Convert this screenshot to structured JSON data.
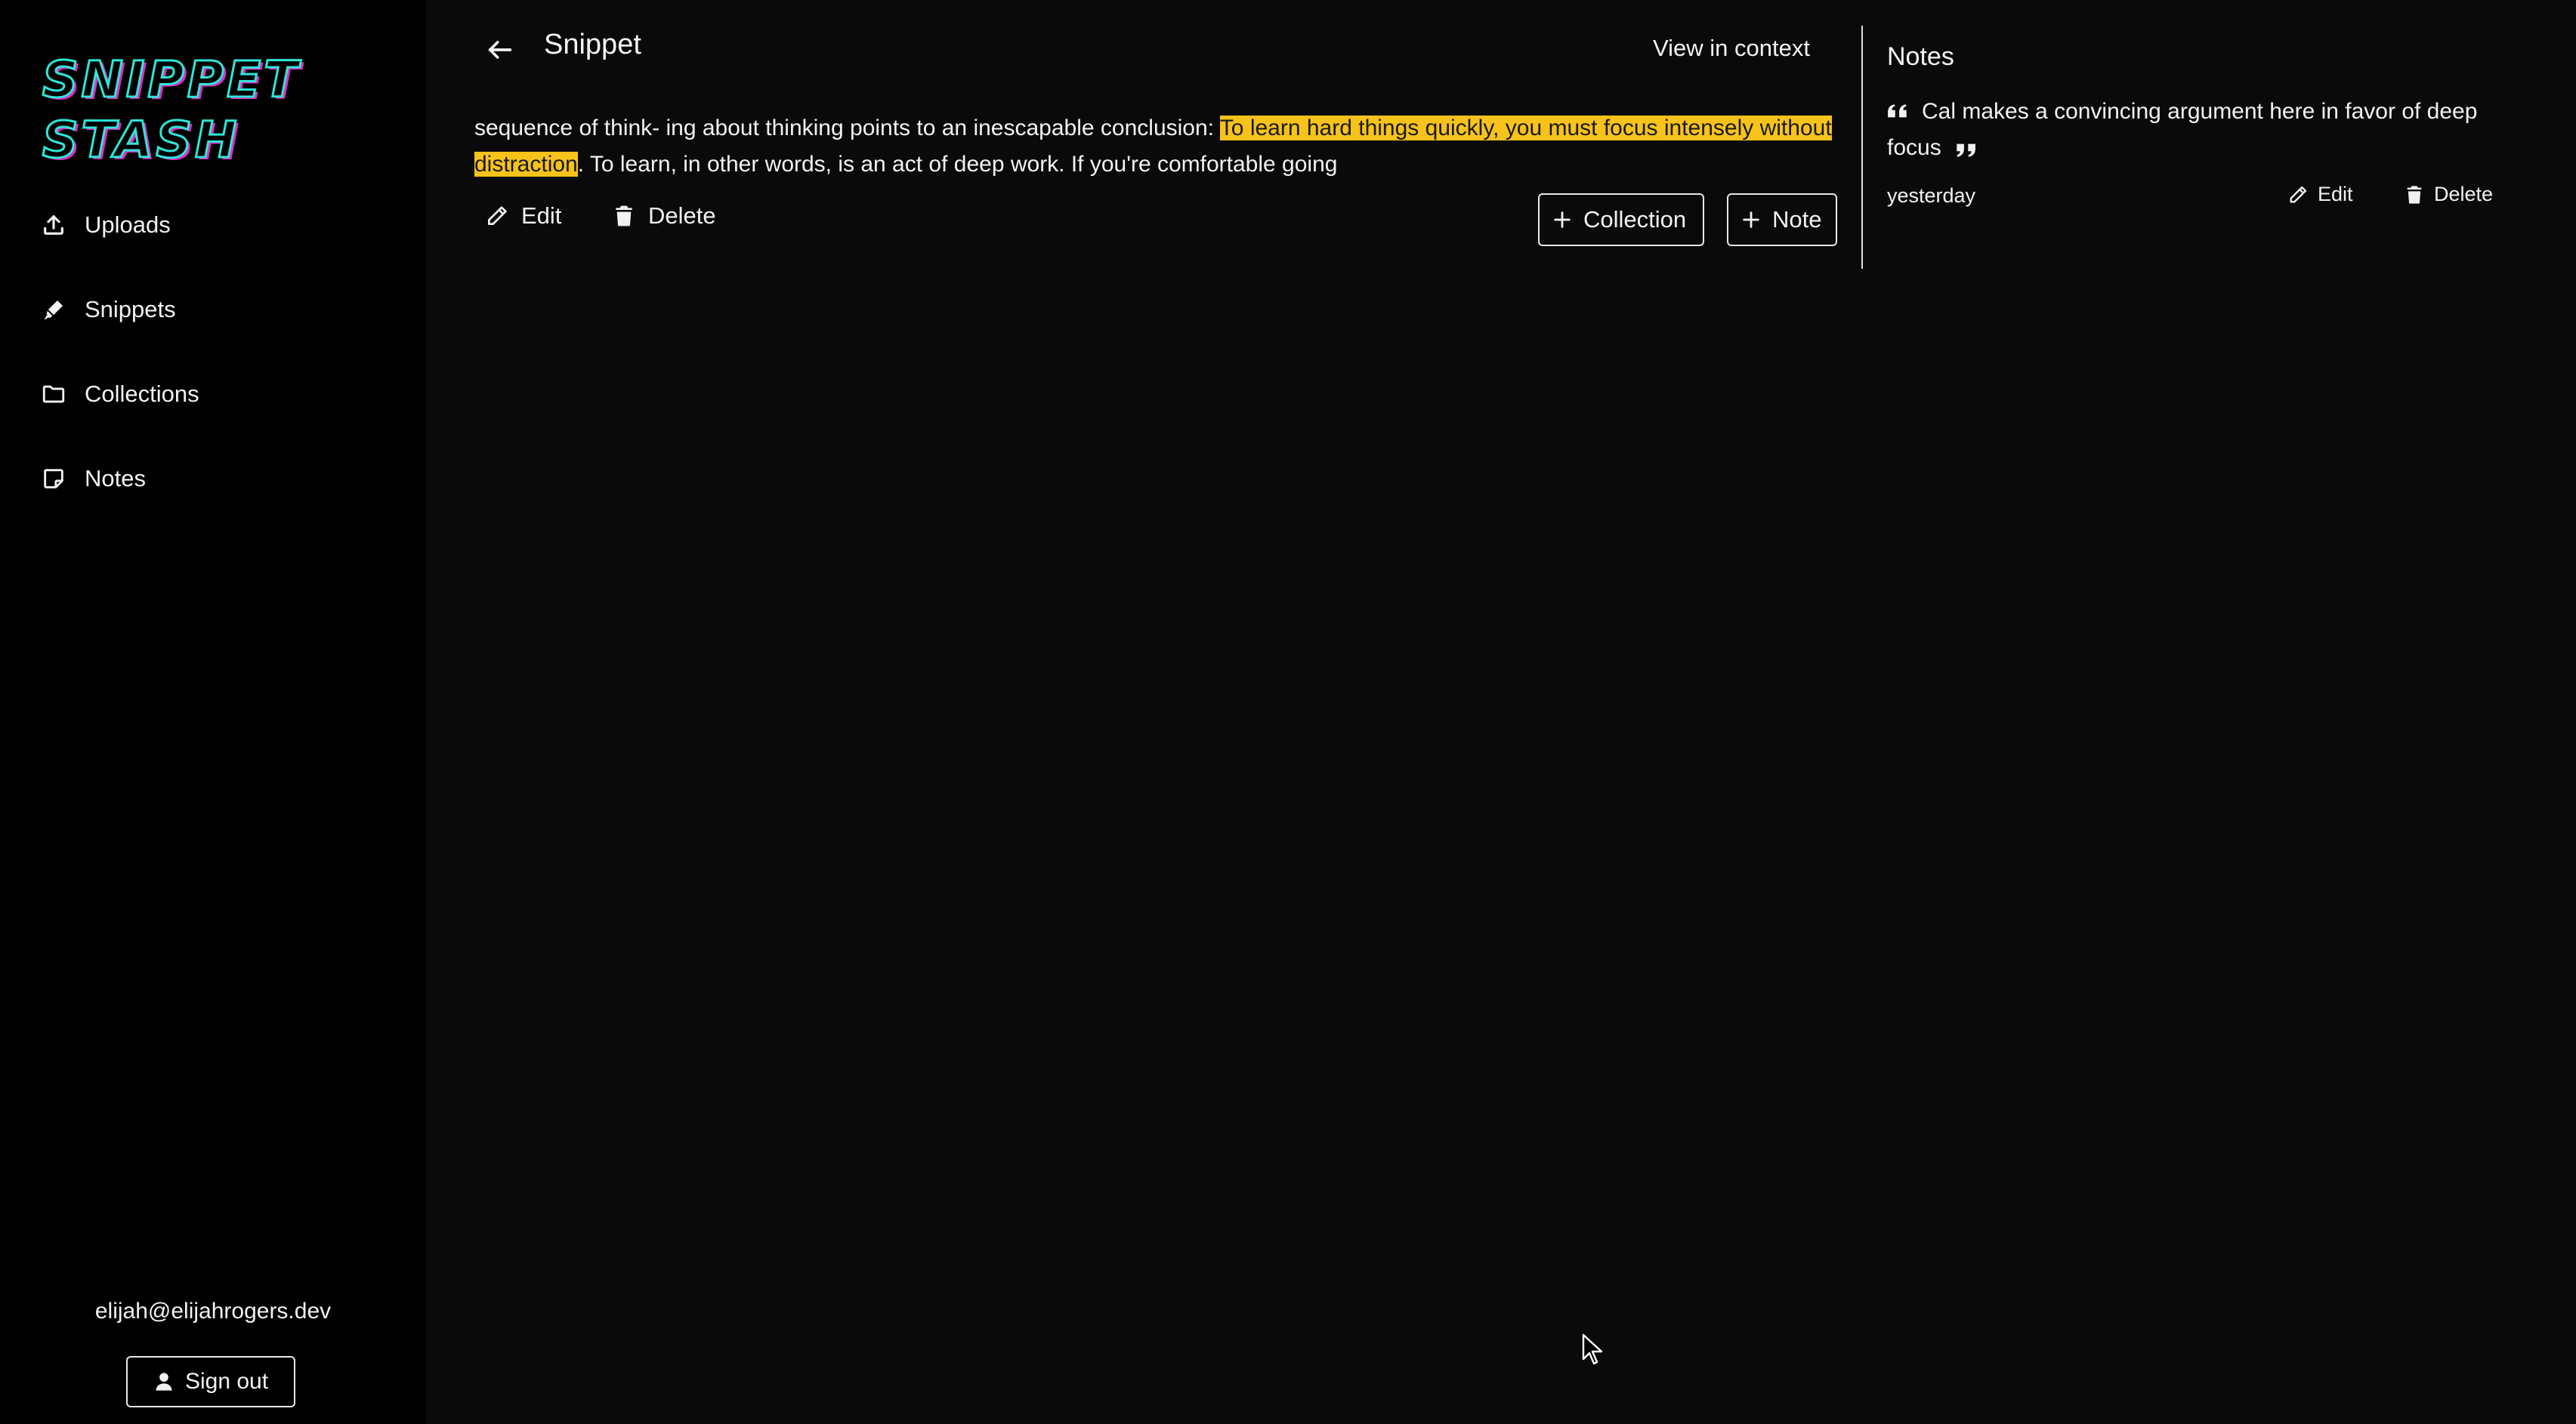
{
  "sidebar": {
    "logo_line1": "SNIPPET",
    "logo_line2": "STASH",
    "items": [
      {
        "label": "Uploads",
        "icon": "upload-icon"
      },
      {
        "label": "Snippets",
        "icon": "highlighter-icon"
      },
      {
        "label": "Collections",
        "icon": "folder-icon"
      },
      {
        "label": "Notes",
        "icon": "sticky-note-icon"
      }
    ],
    "user_email": "elijah@elijahrogers.dev",
    "signout_label": "Sign out"
  },
  "header": {
    "title": "Snippet",
    "view_context_label": "View in context"
  },
  "snippet": {
    "text_before": "sequence of think- ing about thinking points to an inescapable conclusion: ",
    "text_highlight": "To learn hard things quickly, you must focus intensely without distraction",
    "text_after": ". To learn, in other words, is an act of deep work. If you're comfortable going",
    "highlight_color": "#f7c31b"
  },
  "actions": {
    "edit_label": "Edit",
    "delete_label": "Delete",
    "collection_label": "Collection",
    "note_label": "Note"
  },
  "notes_panel": {
    "title": "Notes",
    "notes": [
      {
        "text": "Cal makes a convincing argument here in favor of deep focus",
        "date": "yesterday",
        "edit_label": "Edit",
        "delete_label": "Delete"
      }
    ]
  },
  "colors": {
    "sidebar_bg": "#000000",
    "main_bg": "#0a0a0a",
    "logo_cyan": "#2ee6d6",
    "logo_magenta": "#e02dc3"
  }
}
